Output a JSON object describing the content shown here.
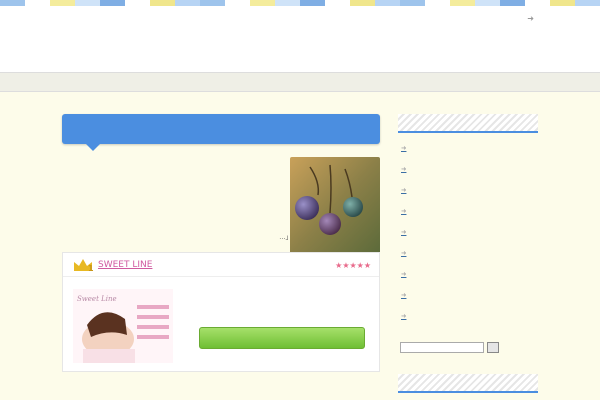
{
  "header": {
    "stripe_colors": [
      "#9ec4ec",
      "#ffffff",
      "#f4ec9c",
      "#cfe3f8",
      "#7faee4",
      "#ffffff",
      "#f0e68c",
      "#b7d4f4"
    ],
    "top_link": "",
    "site_title": "",
    "site_description": "",
    "note": ""
  },
  "nav": {
    "home_label": ""
  },
  "main": {
    "title": "",
    "paragraphs": [
      "",
      "",
      "",
      "...」"
    ]
  },
  "card": {
    "name": "SWEET LINE",
    "rating_prefix": "",
    "rating": "★★★★★",
    "text": "",
    "cta_label": "",
    "ad_text": "Sweet Line"
  },
  "sidebar": {
    "heading1": "",
    "items": [
      "",
      "",
      "",
      "",
      "",
      "",
      "",
      "",
      "",
      ""
    ],
    "search_button": "",
    "heading2": ""
  },
  "colors": {
    "accent": "#4b8ee0",
    "pink": "#d05aa0",
    "green": "#6fbf34"
  }
}
